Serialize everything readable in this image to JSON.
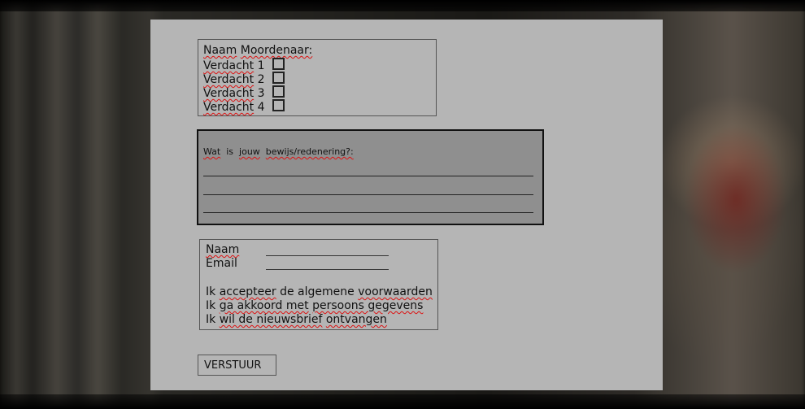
{
  "colors": {
    "panel_background": "#b5b5b5",
    "evidence_background": "#8f8f8f",
    "spellcheck_underline": "#d11111"
  },
  "suspects": {
    "heading_word1": "Naam",
    "heading_word2": "Moordenaar:",
    "items": [
      {
        "label": "Verdacht",
        "number": "1",
        "checked": false
      },
      {
        "label": "Verdacht",
        "number": "2",
        "checked": false
      },
      {
        "label": "Verdacht",
        "number": "3",
        "checked": false
      },
      {
        "label": "Verdacht",
        "number": "4",
        "checked": false
      }
    ]
  },
  "evidence": {
    "question_word1": "Wat",
    "question_word2": "is",
    "question_word3": "jouw",
    "question_word4": "bewijs/redenering?:",
    "lines": [
      "",
      "",
      ""
    ]
  },
  "contact": {
    "name_label": "Naam",
    "name_value": "",
    "email_label": "Email",
    "email_value": "",
    "agreements": [
      {
        "pre": "Ik",
        "key": "accepteer",
        "post": "de algemene",
        "key2": "voorwaarden",
        "tail": ""
      },
      {
        "pre": "Ik",
        "key": "ga akkoord met",
        "post": "",
        "key2": "persoons gegevens",
        "tail": ""
      },
      {
        "pre": "Ik",
        "key": "wil de nieuwsbrief",
        "post": "",
        "key2": "ontvangen",
        "tail": ""
      }
    ]
  },
  "submit": {
    "label": "VERSTUUR"
  }
}
